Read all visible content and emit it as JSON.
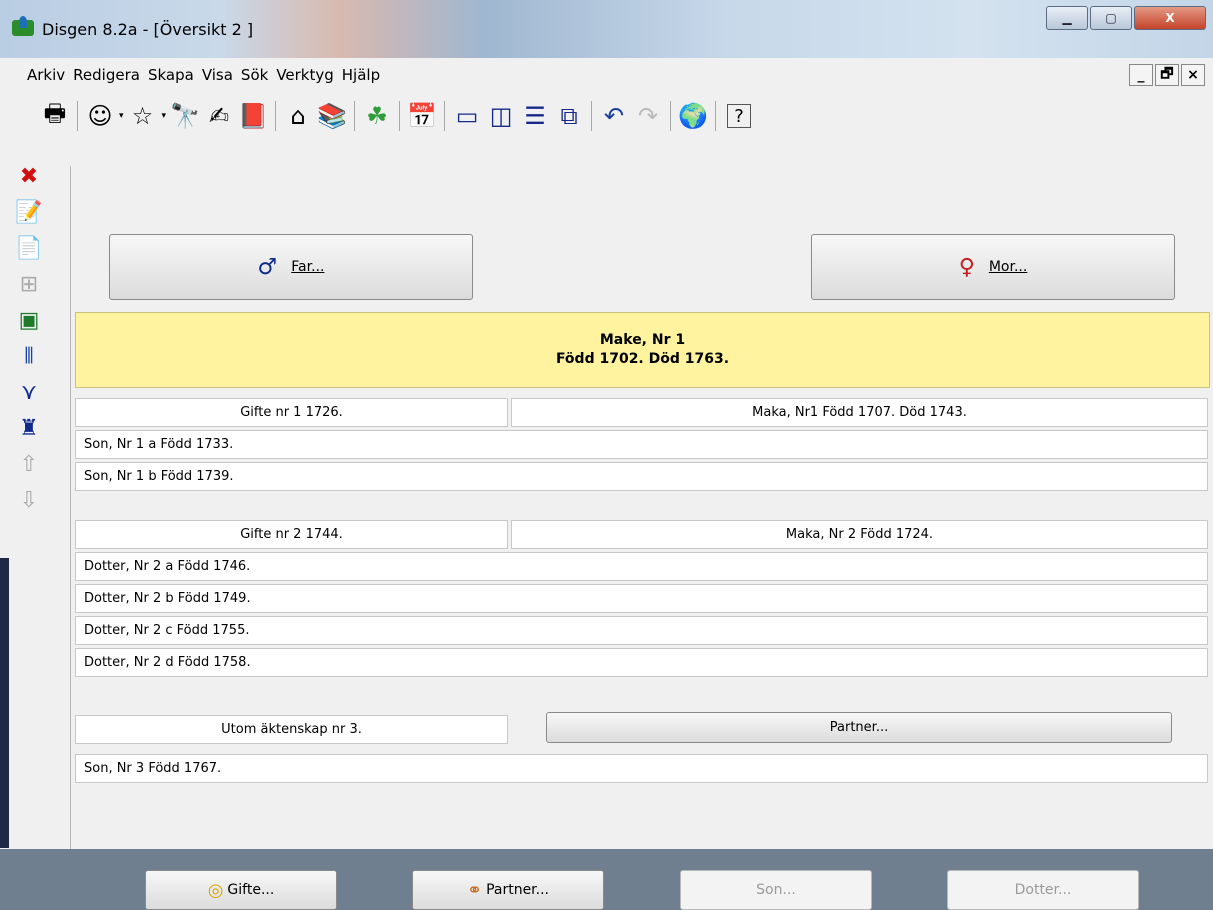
{
  "window": {
    "title": "Disgen 8.2a - [Översikt 2 ]",
    "minimize_label": "▁",
    "maximize_label": "▢",
    "close_label": "X"
  },
  "menu": [
    "Arkiv",
    "Redigera",
    "Skapa",
    "Visa",
    "Sök",
    "Verktyg",
    "Hjälp"
  ],
  "mdi_controls": [
    "_",
    "🗗",
    "×"
  ],
  "parents": {
    "father_label": "Far...",
    "mother_label": "Mor..."
  },
  "person": {
    "line1": "Make, Nr 1",
    "line2": "Född 1702. Död 1763."
  },
  "marriages": [
    {
      "label": "Gifte nr 1 1726.",
      "spouse": "Maka, Nr1 Född 1707. Död 1743.",
      "children": [
        "Son, Nr 1 a Född 1733.",
        "Son, Nr 1 b Född 1739."
      ]
    },
    {
      "label": "Gifte nr 2 1744.",
      "spouse": "Maka, Nr 2 Född 1724.",
      "children": [
        "Dotter, Nr 2 a Född 1746.",
        "Dotter, Nr 2 b Född 1749.",
        "Dotter, Nr 2 c Född 1755.",
        "Dotter, Nr 2 d Född 1758."
      ]
    },
    {
      "label": "Utom äktenskap nr 3.",
      "partner_button": "Partner...",
      "children": [
        "Son, Nr 3 Född 1767."
      ]
    }
  ],
  "bottom_buttons": {
    "gifte": "Gifte...",
    "partner": "Partner...",
    "son": "Son...",
    "dotter": "Dotter..."
  },
  "colors": {
    "person_card": "#fff3a0",
    "father": "#0b2a8c",
    "mother": "#c51d1d"
  }
}
